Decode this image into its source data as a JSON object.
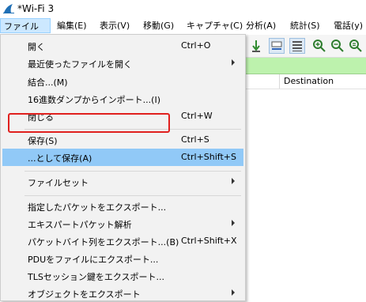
{
  "window": {
    "title": "*Wi-Fi 3"
  },
  "menubar": [
    "ファイル(F)",
    "編集(E)",
    "表示(V)",
    "移動(G)",
    "キャプチャ(C)",
    "分析(A)",
    "統計(S)",
    "電話(y)"
  ],
  "packet_list": {
    "destination_header": "Destination"
  },
  "file_menu": {
    "items": [
      {
        "label": "開く",
        "shortcut": "Ctrl+O"
      },
      {
        "label": "最近使ったファイルを開く",
        "shortcut": ""
      },
      {
        "label": "結合...(M)",
        "shortcut": ""
      },
      {
        "label": "16進数ダンプからインポート...(I)",
        "shortcut": ""
      },
      {
        "label": "閉じる",
        "shortcut": "Ctrl+W"
      },
      {
        "label": "保存(S)",
        "shortcut": "Ctrl+S"
      },
      {
        "label": "...として保存(A)",
        "shortcut": "Ctrl+Shift+S"
      },
      {
        "label": "ファイルセット",
        "shortcut": ""
      },
      {
        "label": "指定したパケットをエクスポート...",
        "shortcut": ""
      },
      {
        "label": "エキスパートパケット解析",
        "shortcut": ""
      },
      {
        "label": "パケットバイト列をエクスポート...(B)",
        "shortcut": "Ctrl+Shift+X"
      },
      {
        "label": "PDUをファイルにエクスポート...",
        "shortcut": ""
      },
      {
        "label": "TLSセッション鍵をエクスポート...",
        "shortcut": ""
      },
      {
        "label": "オブジェクトをエクスポート",
        "shortcut": ""
      }
    ]
  },
  "colors": {
    "highlight": "#91c9f7",
    "annotation": "#e0201e",
    "filter_bar": "#bdf2ad"
  }
}
